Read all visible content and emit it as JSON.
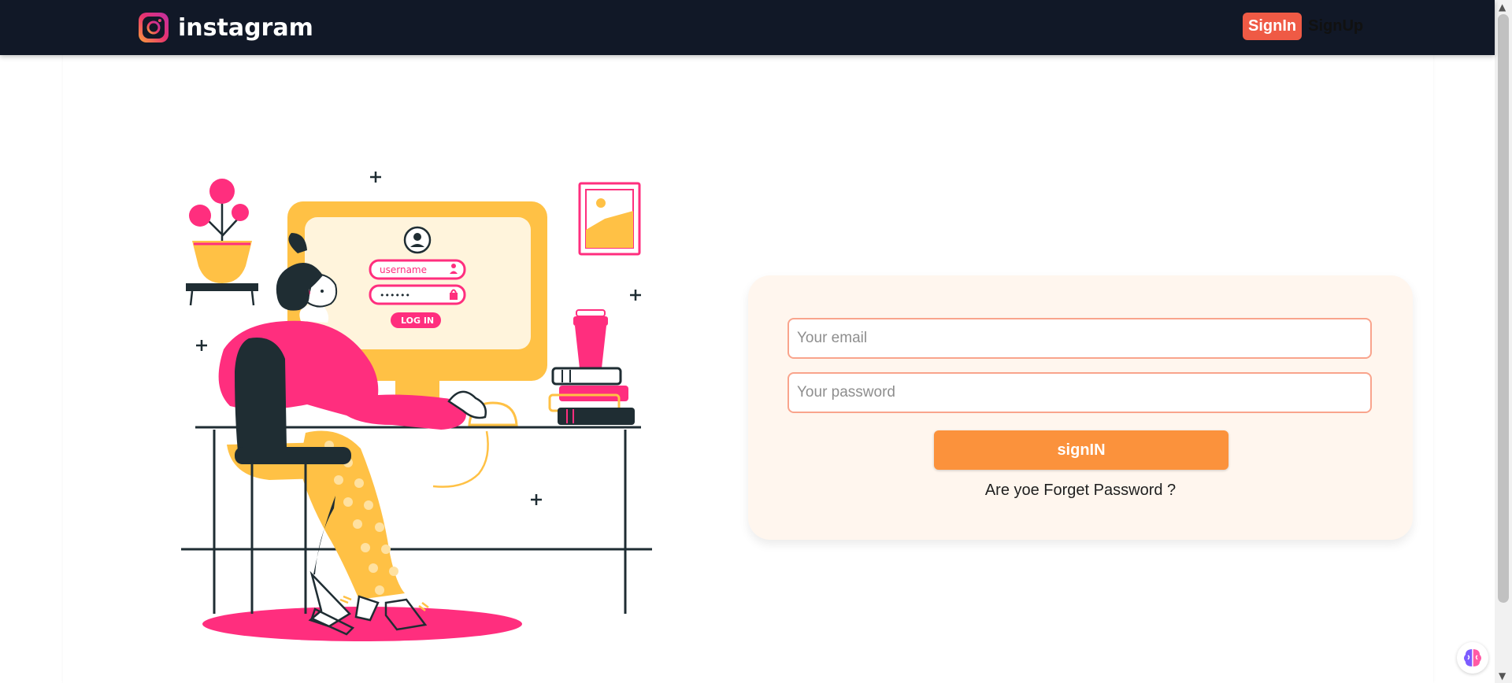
{
  "navbar": {
    "brand_name": "instagram",
    "signin_label": "SignIn",
    "signup_label": "SignUp"
  },
  "illustration": {
    "screen_username": "username",
    "screen_password": "••••••",
    "screen_login": "LOG IN"
  },
  "form": {
    "email_placeholder": "Your email",
    "password_placeholder": "Your password",
    "submit_label": "signIN",
    "forgot_label": "Are yoe Forget Password ?"
  },
  "colors": {
    "navbar_bg": "#111827",
    "accent_red": "#ef5a45",
    "button_orange": "#fb923c",
    "card_bg": "#fff6ee",
    "pink": "#ff2e7e",
    "yellow": "#ffc145"
  }
}
